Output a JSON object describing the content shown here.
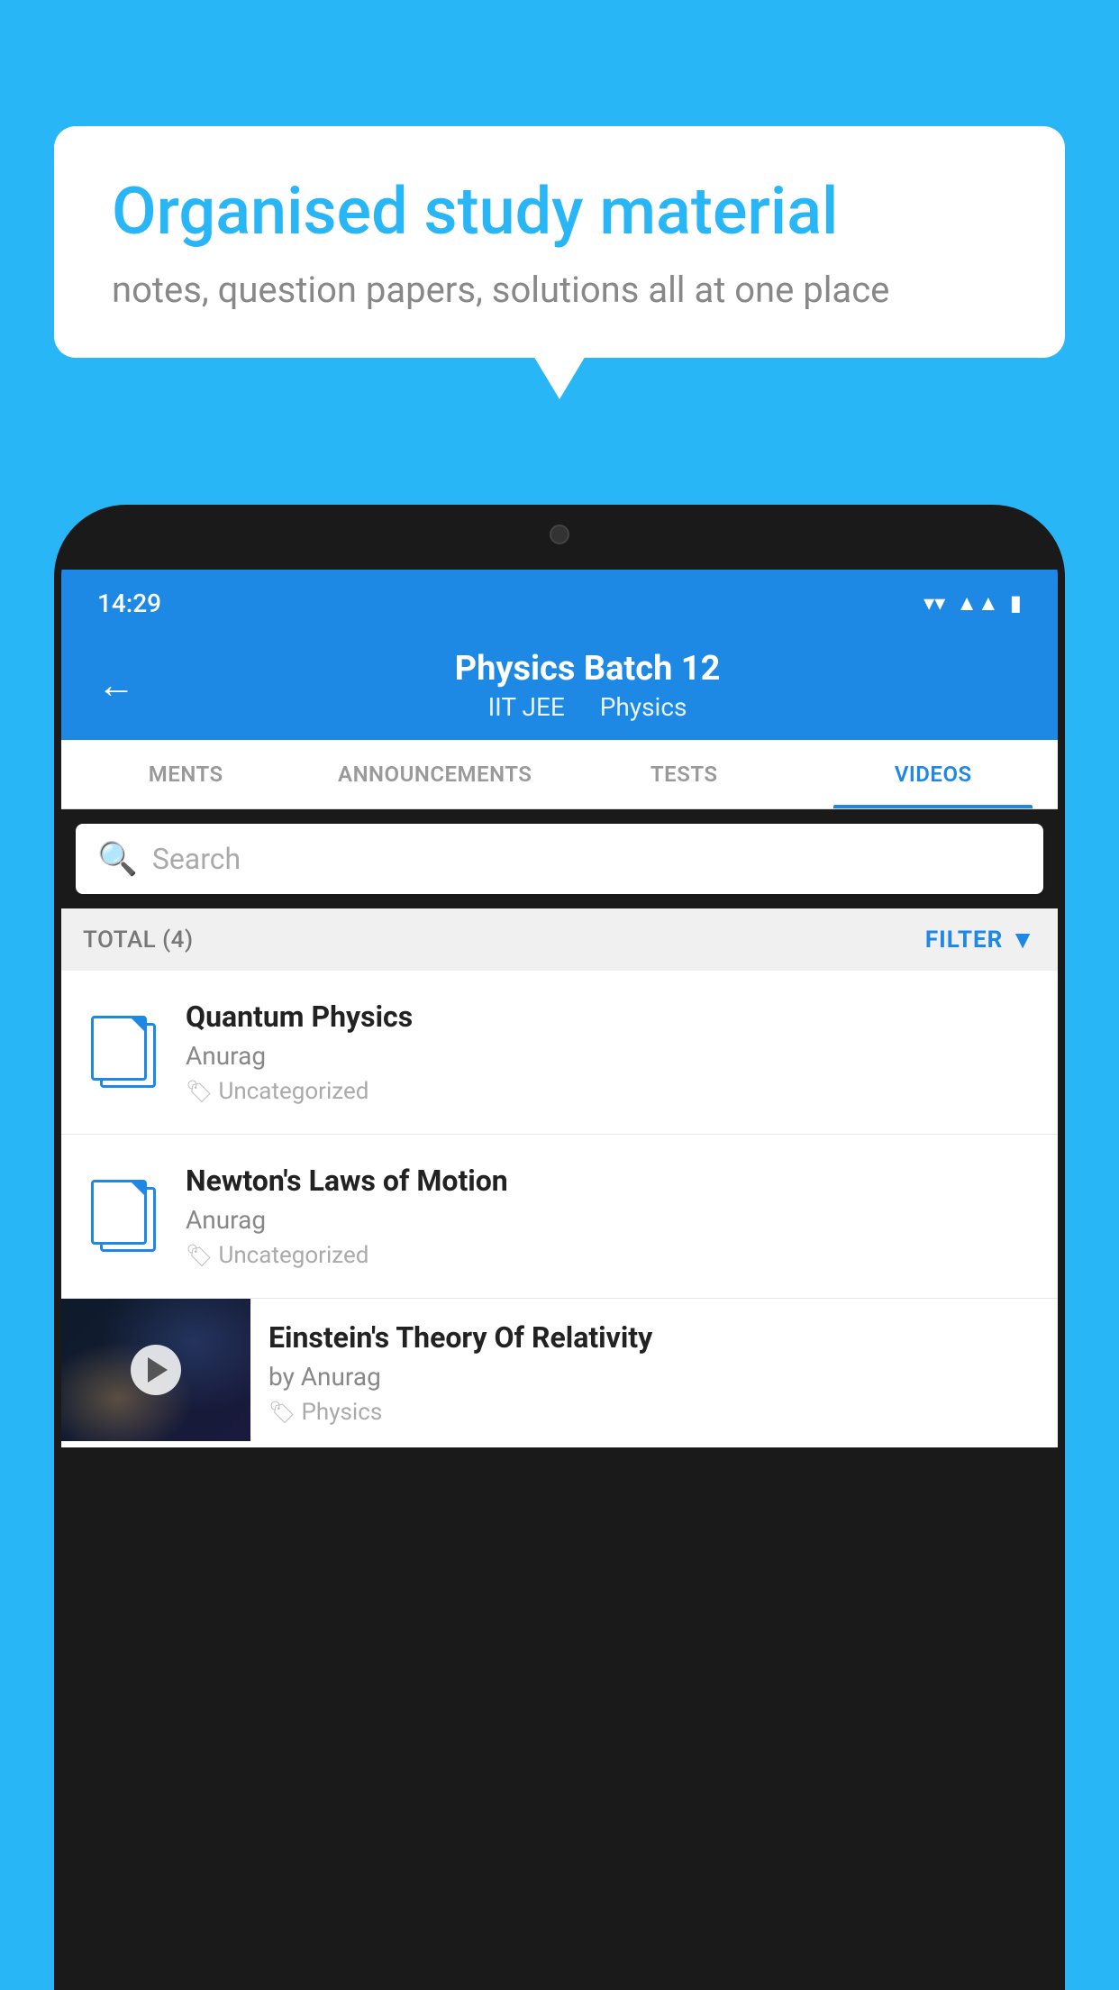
{
  "background_color": "#29b6f6",
  "bubble": {
    "title": "Organised study material",
    "subtitle": "notes, question papers, solutions all at one place"
  },
  "phone": {
    "status_bar": {
      "time": "14:29",
      "icons": [
        "wifi",
        "signal",
        "battery"
      ]
    },
    "header": {
      "title": "Physics Batch 12",
      "subtitle_parts": [
        "IIT JEE",
        "Physics"
      ],
      "back_label": "←"
    },
    "tabs": [
      {
        "label": "MENTS",
        "active": false
      },
      {
        "label": "ANNOUNCEMENTS",
        "active": false
      },
      {
        "label": "TESTS",
        "active": false
      },
      {
        "label": "VIDEOS",
        "active": true
      }
    ],
    "search": {
      "placeholder": "Search"
    },
    "filter": {
      "total_label": "TOTAL (4)",
      "filter_label": "FILTER"
    },
    "videos": [
      {
        "id": 1,
        "title": "Quantum Physics",
        "author": "Anurag",
        "tag": "Uncategorized",
        "type": "file"
      },
      {
        "id": 2,
        "title": "Newton's Laws of Motion",
        "author": "Anurag",
        "tag": "Uncategorized",
        "type": "file"
      },
      {
        "id": 3,
        "title": "Einstein's Theory Of Relativity",
        "author": "by Anurag",
        "tag": "Physics",
        "type": "thumb"
      }
    ]
  }
}
